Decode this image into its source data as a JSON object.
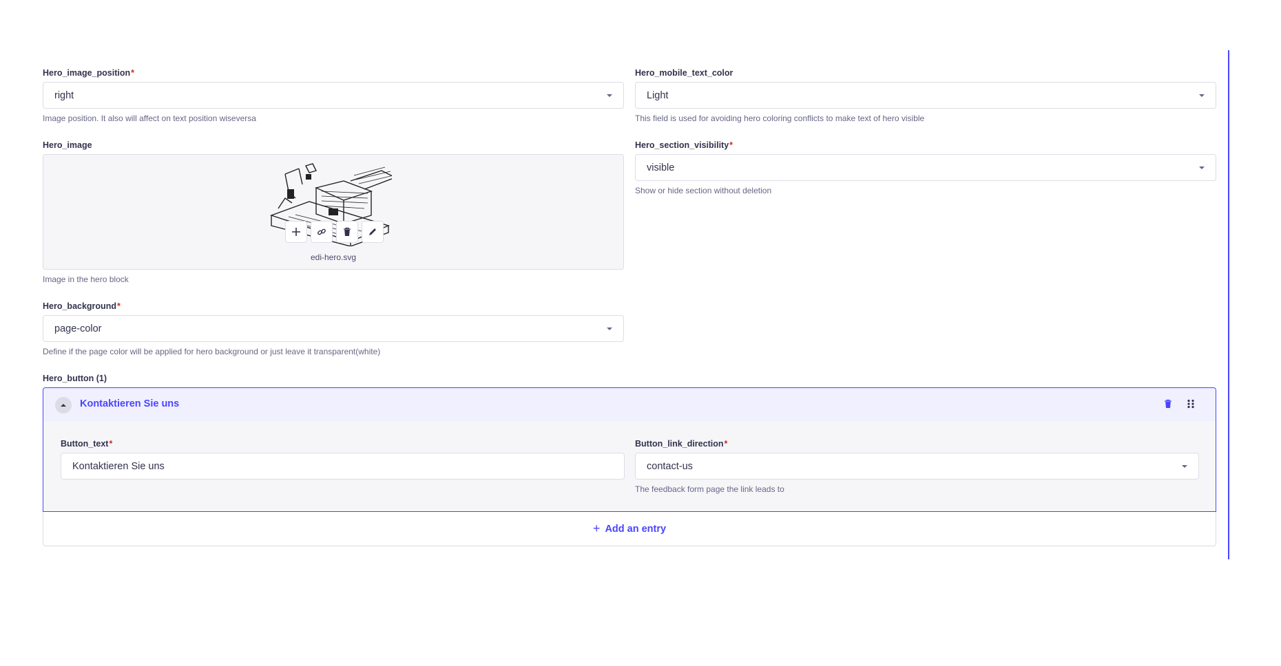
{
  "fields": {
    "hero_image_position": {
      "label": "Hero_image_position",
      "required_mark": "*",
      "value": "right",
      "hint": "Image position. It also will affect on text position wiseversa"
    },
    "hero_mobile_text_color": {
      "label": "Hero_mobile_text_color",
      "value": "Light",
      "hint": "This field is used for avoiding hero coloring conflicts to make text of hero visible"
    },
    "hero_image": {
      "label": "Hero_image",
      "filename": "edi-hero.svg",
      "hint": "Image in the hero block",
      "actions": [
        "add-icon",
        "link-icon",
        "trash-icon",
        "pencil-icon"
      ]
    },
    "hero_section_visibility": {
      "label": "Hero_section_visibility",
      "required_mark": "*",
      "value": "visible",
      "hint": "Show or hide section without deletion"
    },
    "hero_background": {
      "label": "Hero_background",
      "required_mark": "*",
      "value": "page-color",
      "hint": "Define if the page color will be applied for hero background or just leave it transparent(white)"
    }
  },
  "hero_button": {
    "label": "Hero_button (1)",
    "entry_title": "Kontaktieren Sie uns",
    "button_text": {
      "label": "Button_text",
      "required_mark": "*",
      "value": "Kontaktieren Sie uns"
    },
    "button_link_direction": {
      "label": "Button_link_direction",
      "required_mark": "*",
      "value": "contact-us",
      "hint": "The feedback form page the link leads to"
    },
    "add_entry": {
      "icon": "+",
      "label": "Add an entry"
    }
  },
  "colors": {
    "accent": "#4945ff",
    "required": "#d02b20",
    "text": "#32324d",
    "hint": "#666687",
    "border": "#dcdce4",
    "panel_bg": "#f6f6f9",
    "header_bg": "#f0f0ff"
  }
}
